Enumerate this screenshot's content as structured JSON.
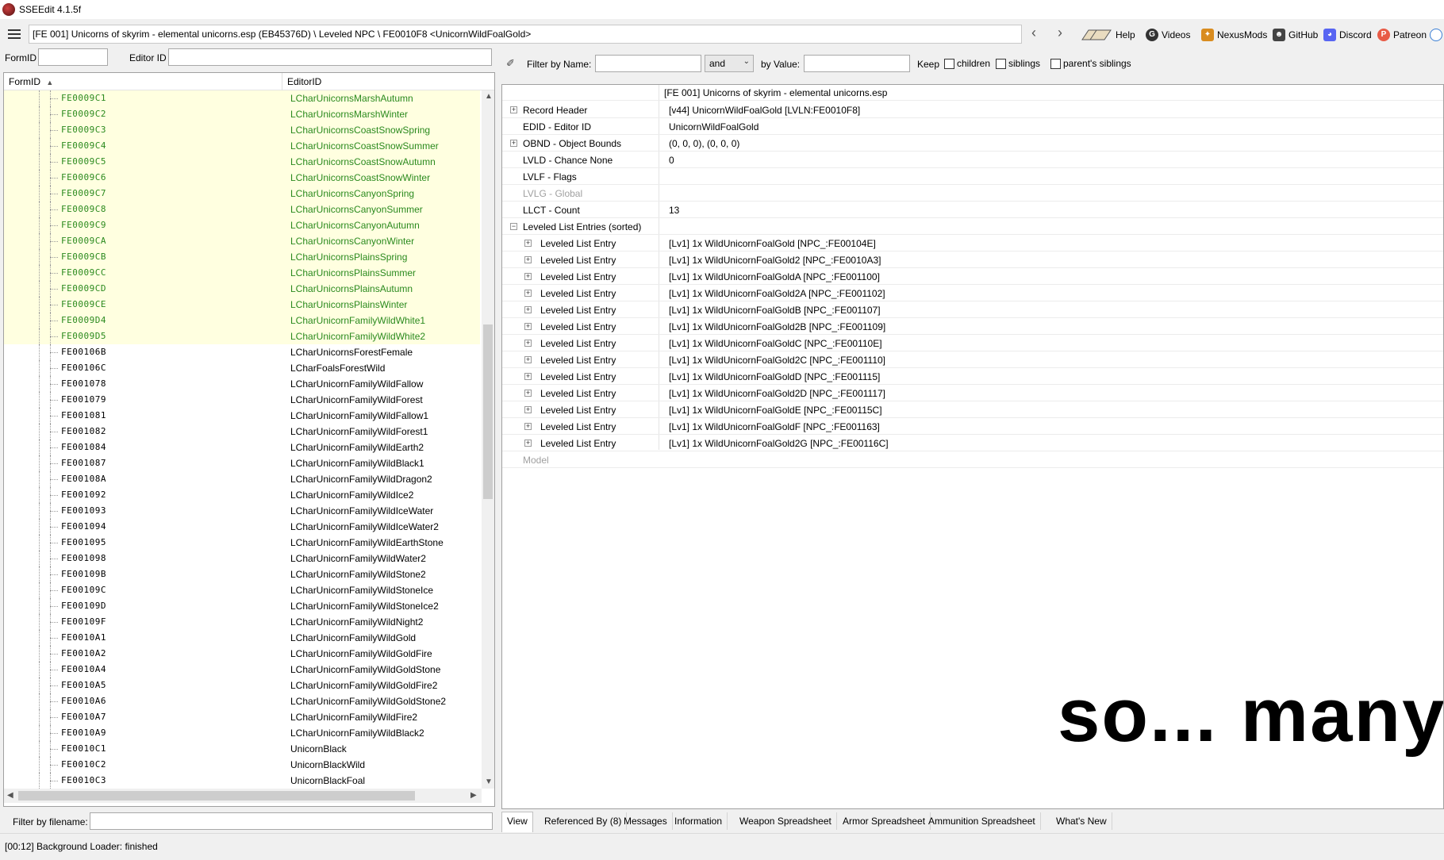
{
  "app": {
    "title": "SSEEdit 4.1.5f"
  },
  "toolbar": {
    "path": "[FE 001] Unicorns of skyrim - elemental unicorns.esp (EB45376D) \\ Leveled NPC \\ FE0010F8 <UnicornWildFoalGold>",
    "back_icon": "chevron-left-icon",
    "forward_icon": "chevron-right-icon",
    "links": [
      {
        "label": "Help",
        "icon": "book-icon"
      },
      {
        "label": "Videos",
        "icon": "video-icon"
      },
      {
        "label": "NexusMods",
        "icon": "nexusmods-icon"
      },
      {
        "label": "GitHub",
        "icon": "github-icon"
      },
      {
        "label": "Discord",
        "icon": "discord-icon"
      },
      {
        "label": "Patreon",
        "icon": "patreon-icon"
      }
    ]
  },
  "left_pane": {
    "formid_label": "FormID",
    "formid_value": "",
    "editorid_label": "Editor ID",
    "editorid_value": "",
    "columns": {
      "formid": "FormID",
      "editorid": "EditorID"
    },
    "sort_indicator": "▲",
    "rows": [
      {
        "fid": "FE0009C1",
        "eid": "LCharUnicornsMarshAutumn",
        "hl": true
      },
      {
        "fid": "FE0009C2",
        "eid": "LCharUnicornsMarshWinter",
        "hl": true
      },
      {
        "fid": "FE0009C3",
        "eid": "LCharUnicornsCoastSnowSpring",
        "hl": true
      },
      {
        "fid": "FE0009C4",
        "eid": "LCharUnicornsCoastSnowSummer",
        "hl": true
      },
      {
        "fid": "FE0009C5",
        "eid": "LCharUnicornsCoastSnowAutumn",
        "hl": true
      },
      {
        "fid": "FE0009C6",
        "eid": "LCharUnicornsCoastSnowWinter",
        "hl": true
      },
      {
        "fid": "FE0009C7",
        "eid": "LCharUnicornsCanyonSpring",
        "hl": true
      },
      {
        "fid": "FE0009C8",
        "eid": "LCharUnicornsCanyonSummer",
        "hl": true
      },
      {
        "fid": "FE0009C9",
        "eid": "LCharUnicornsCanyonAutumn",
        "hl": true
      },
      {
        "fid": "FE0009CA",
        "eid": "LCharUnicornsCanyonWinter",
        "hl": true
      },
      {
        "fid": "FE0009CB",
        "eid": "LCharUnicornsPlainsSpring",
        "hl": true
      },
      {
        "fid": "FE0009CC",
        "eid": "LCharUnicornsPlainsSummer",
        "hl": true
      },
      {
        "fid": "FE0009CD",
        "eid": "LCharUnicornsPlainsAutumn",
        "hl": true
      },
      {
        "fid": "FE0009CE",
        "eid": "LCharUnicornsPlainsWinter",
        "hl": true
      },
      {
        "fid": "FE0009D4",
        "eid": "LCharUnicornFamilyWildWhite1",
        "hl": true
      },
      {
        "fid": "FE0009D5",
        "eid": "LCharUnicornFamilyWildWhite2",
        "hl": true
      },
      {
        "fid": "FE00106B",
        "eid": "LCharUnicornsForestFemale",
        "hl": false
      },
      {
        "fid": "FE00106C",
        "eid": "LCharFoalsForestWild",
        "hl": false
      },
      {
        "fid": "FE001078",
        "eid": "LCharUnicornFamilyWildFallow",
        "hl": false
      },
      {
        "fid": "FE001079",
        "eid": "LCharUnicornFamilyWildForest",
        "hl": false
      },
      {
        "fid": "FE001081",
        "eid": "LCharUnicornFamilyWildFallow1",
        "hl": false
      },
      {
        "fid": "FE001082",
        "eid": "LCharUnicornFamilyWildForest1",
        "hl": false
      },
      {
        "fid": "FE001084",
        "eid": "LCharUnicornFamilyWildEarth2",
        "hl": false
      },
      {
        "fid": "FE001087",
        "eid": "LCharUnicornFamilyWildBlack1",
        "hl": false
      },
      {
        "fid": "FE00108A",
        "eid": "LCharUnicornFamilyWildDragon2",
        "hl": false
      },
      {
        "fid": "FE001092",
        "eid": "LCharUnicornFamilyWildIce2",
        "hl": false
      },
      {
        "fid": "FE001093",
        "eid": "LCharUnicornFamilyWildIceWater",
        "hl": false
      },
      {
        "fid": "FE001094",
        "eid": "LCharUnicornFamilyWildIceWater2",
        "hl": false
      },
      {
        "fid": "FE001095",
        "eid": "LCharUnicornFamilyWildEarthStone",
        "hl": false
      },
      {
        "fid": "FE001098",
        "eid": "LCharUnicornFamilyWildWater2",
        "hl": false
      },
      {
        "fid": "FE00109B",
        "eid": "LCharUnicornFamilyWildStone2",
        "hl": false
      },
      {
        "fid": "FE00109C",
        "eid": "LCharUnicornFamilyWildStoneIce",
        "hl": false
      },
      {
        "fid": "FE00109D",
        "eid": "LCharUnicornFamilyWildStoneIce2",
        "hl": false
      },
      {
        "fid": "FE00109F",
        "eid": "LCharUnicornFamilyWildNight2",
        "hl": false
      },
      {
        "fid": "FE0010A1",
        "eid": "LCharUnicornFamilyWildGold",
        "hl": false
      },
      {
        "fid": "FE0010A2",
        "eid": "LCharUnicornFamilyWildGoldFire",
        "hl": false
      },
      {
        "fid": "FE0010A4",
        "eid": "LCharUnicornFamilyWildGoldStone",
        "hl": false
      },
      {
        "fid": "FE0010A5",
        "eid": "LCharUnicornFamilyWildGoldFire2",
        "hl": false
      },
      {
        "fid": "FE0010A6",
        "eid": "LCharUnicornFamilyWildGoldStone2",
        "hl": false
      },
      {
        "fid": "FE0010A7",
        "eid": "LCharUnicornFamilyWildFire2",
        "hl": false
      },
      {
        "fid": "FE0010A9",
        "eid": "LCharUnicornFamilyWildBlack2",
        "hl": false
      },
      {
        "fid": "FE0010C1",
        "eid": "UnicornBlack",
        "hl": false
      },
      {
        "fid": "FE0010C2",
        "eid": "UnicornBlackWild",
        "hl": false
      },
      {
        "fid": "FE0010C3",
        "eid": "UnicornBlackFoal",
        "hl": false
      }
    ],
    "filename_filter_label": "Filter by filename:",
    "filename_filter_value": ""
  },
  "right_pane": {
    "filter": {
      "name_label": "Filter by Name:",
      "name_value": "",
      "logic": "and",
      "value_label": "by Value:",
      "value_value": "",
      "keep_label": "Keep",
      "children_label": "children",
      "siblings_label": "siblings",
      "parents_siblings_label": "parent's siblings"
    },
    "file_header": "[FE 001] Unicorns of skyrim - elemental unicorns.esp",
    "fields": [
      {
        "name": "Record Header",
        "value": "[v44] UnicornWildFoalGold [LVLN:FE0010F8]",
        "expand": true,
        "indent": 0,
        "dim": false
      },
      {
        "name": "EDID - Editor ID",
        "value": "UnicornWildFoalGold",
        "expand": false,
        "indent": 0,
        "dim": false
      },
      {
        "name": "OBND - Object Bounds",
        "value": "(0, 0, 0), (0, 0, 0)",
        "expand": true,
        "indent": 0,
        "dim": false
      },
      {
        "name": "LVLD - Chance None",
        "value": "0",
        "expand": false,
        "indent": 0,
        "dim": false
      },
      {
        "name": "LVLF - Flags",
        "value": "",
        "expand": false,
        "indent": 0,
        "dim": false
      },
      {
        "name": "LVLG - Global",
        "value": "",
        "expand": false,
        "indent": 0,
        "dim": true
      },
      {
        "name": "LLCT - Count",
        "value": "13",
        "expand": false,
        "indent": 0,
        "dim": false
      },
      {
        "name": "Leveled List Entries (sorted)",
        "value": "",
        "expand": "minus",
        "indent": 0,
        "dim": false
      },
      {
        "name": "Leveled List Entry",
        "value": "[Lv1] 1x WildUnicornFoalGold [NPC_:FE00104E]",
        "expand": true,
        "indent": 1,
        "dim": false
      },
      {
        "name": "Leveled List Entry",
        "value": "[Lv1] 1x WildUnicornFoalGold2 [NPC_:FE0010A3]",
        "expand": true,
        "indent": 1,
        "dim": false
      },
      {
        "name": "Leveled List Entry",
        "value": "[Lv1] 1x WildUnicornFoalGoldA [NPC_:FE001100]",
        "expand": true,
        "indent": 1,
        "dim": false
      },
      {
        "name": "Leveled List Entry",
        "value": "[Lv1] 1x WildUnicornFoalGold2A [NPC_:FE001102]",
        "expand": true,
        "indent": 1,
        "dim": false
      },
      {
        "name": "Leveled List Entry",
        "value": "[Lv1] 1x WildUnicornFoalGoldB [NPC_:FE001107]",
        "expand": true,
        "indent": 1,
        "dim": false
      },
      {
        "name": "Leveled List Entry",
        "value": "[Lv1] 1x WildUnicornFoalGold2B [NPC_:FE001109]",
        "expand": true,
        "indent": 1,
        "dim": false
      },
      {
        "name": "Leveled List Entry",
        "value": "[Lv1] 1x WildUnicornFoalGoldC [NPC_:FE00110E]",
        "expand": true,
        "indent": 1,
        "dim": false
      },
      {
        "name": "Leveled List Entry",
        "value": "[Lv1] 1x WildUnicornFoalGold2C [NPC_:FE001110]",
        "expand": true,
        "indent": 1,
        "dim": false
      },
      {
        "name": "Leveled List Entry",
        "value": "[Lv1] 1x WildUnicornFoalGoldD [NPC_:FE001115]",
        "expand": true,
        "indent": 1,
        "dim": false
      },
      {
        "name": "Leveled List Entry",
        "value": "[Lv1] 1x WildUnicornFoalGold2D [NPC_:FE001117]",
        "expand": true,
        "indent": 1,
        "dim": false
      },
      {
        "name": "Leveled List Entry",
        "value": "[Lv1] 1x WildUnicornFoalGoldE [NPC_:FE00115C]",
        "expand": true,
        "indent": 1,
        "dim": false
      },
      {
        "name": "Leveled List Entry",
        "value": "[Lv1] 1x WildUnicornFoalGoldF [NPC_:FE001163]",
        "expand": true,
        "indent": 1,
        "dim": false
      },
      {
        "name": "Leveled List Entry",
        "value": "[Lv1] 1x WildUnicornFoalGold2G [NPC_:FE00116C]",
        "expand": true,
        "indent": 1,
        "dim": false
      },
      {
        "name": "Model",
        "value": "",
        "expand": false,
        "indent": 0,
        "dim": true
      }
    ],
    "overlay_text": "so... many... lists....",
    "tabs": [
      {
        "label": "View",
        "active": true
      },
      {
        "label": "Referenced By (8)",
        "active": false
      },
      {
        "label": "Messages",
        "active": false
      },
      {
        "label": "Information",
        "active": false
      },
      {
        "label": "Weapon Spreadsheet",
        "active": false
      },
      {
        "label": "Armor Spreadsheet",
        "active": false
      },
      {
        "label": "Ammunition Spreadsheet",
        "active": false
      },
      {
        "label": "What's New",
        "active": false
      }
    ]
  },
  "status": {
    "text": "[00:12] Background Loader: finished"
  },
  "colors": {
    "highlight_row": "#ffffe0",
    "highlight_text": "#2b8a1e"
  }
}
